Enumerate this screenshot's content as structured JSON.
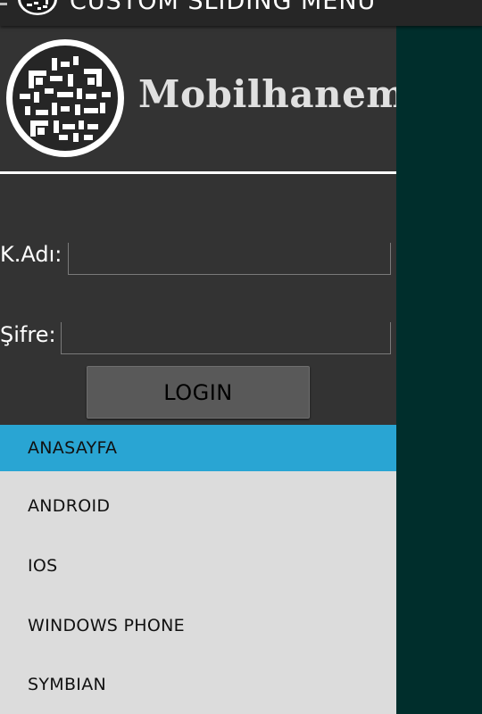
{
  "app": {
    "title": "CUSTOM SLIDING MENU",
    "app_icon": "qr-code-icon"
  },
  "drawer": {
    "brand": {
      "name": "Mobilhanem",
      "logo_icon": "qr-code-logo-icon"
    },
    "login_form": {
      "username_label": "K.Adı:",
      "username_value": "",
      "password_label": "Şifre:",
      "password_value": "",
      "login_label": "LOGIN"
    },
    "menu": {
      "items": [
        {
          "label": "ANASAYFA",
          "selected": true
        },
        {
          "label": "ANDROID",
          "selected": false
        },
        {
          "label": "IOS",
          "selected": false
        },
        {
          "label": "WINDOWS PHONE",
          "selected": false
        },
        {
          "label": "SYMBIAN",
          "selected": false
        }
      ]
    }
  },
  "colors": {
    "action_bar": "#262626",
    "drawer_background": "#333333",
    "menu_background": "#dcdcdc",
    "menu_selected": "#29a5d3",
    "content_background": "#002e2c",
    "button": "#595959"
  }
}
